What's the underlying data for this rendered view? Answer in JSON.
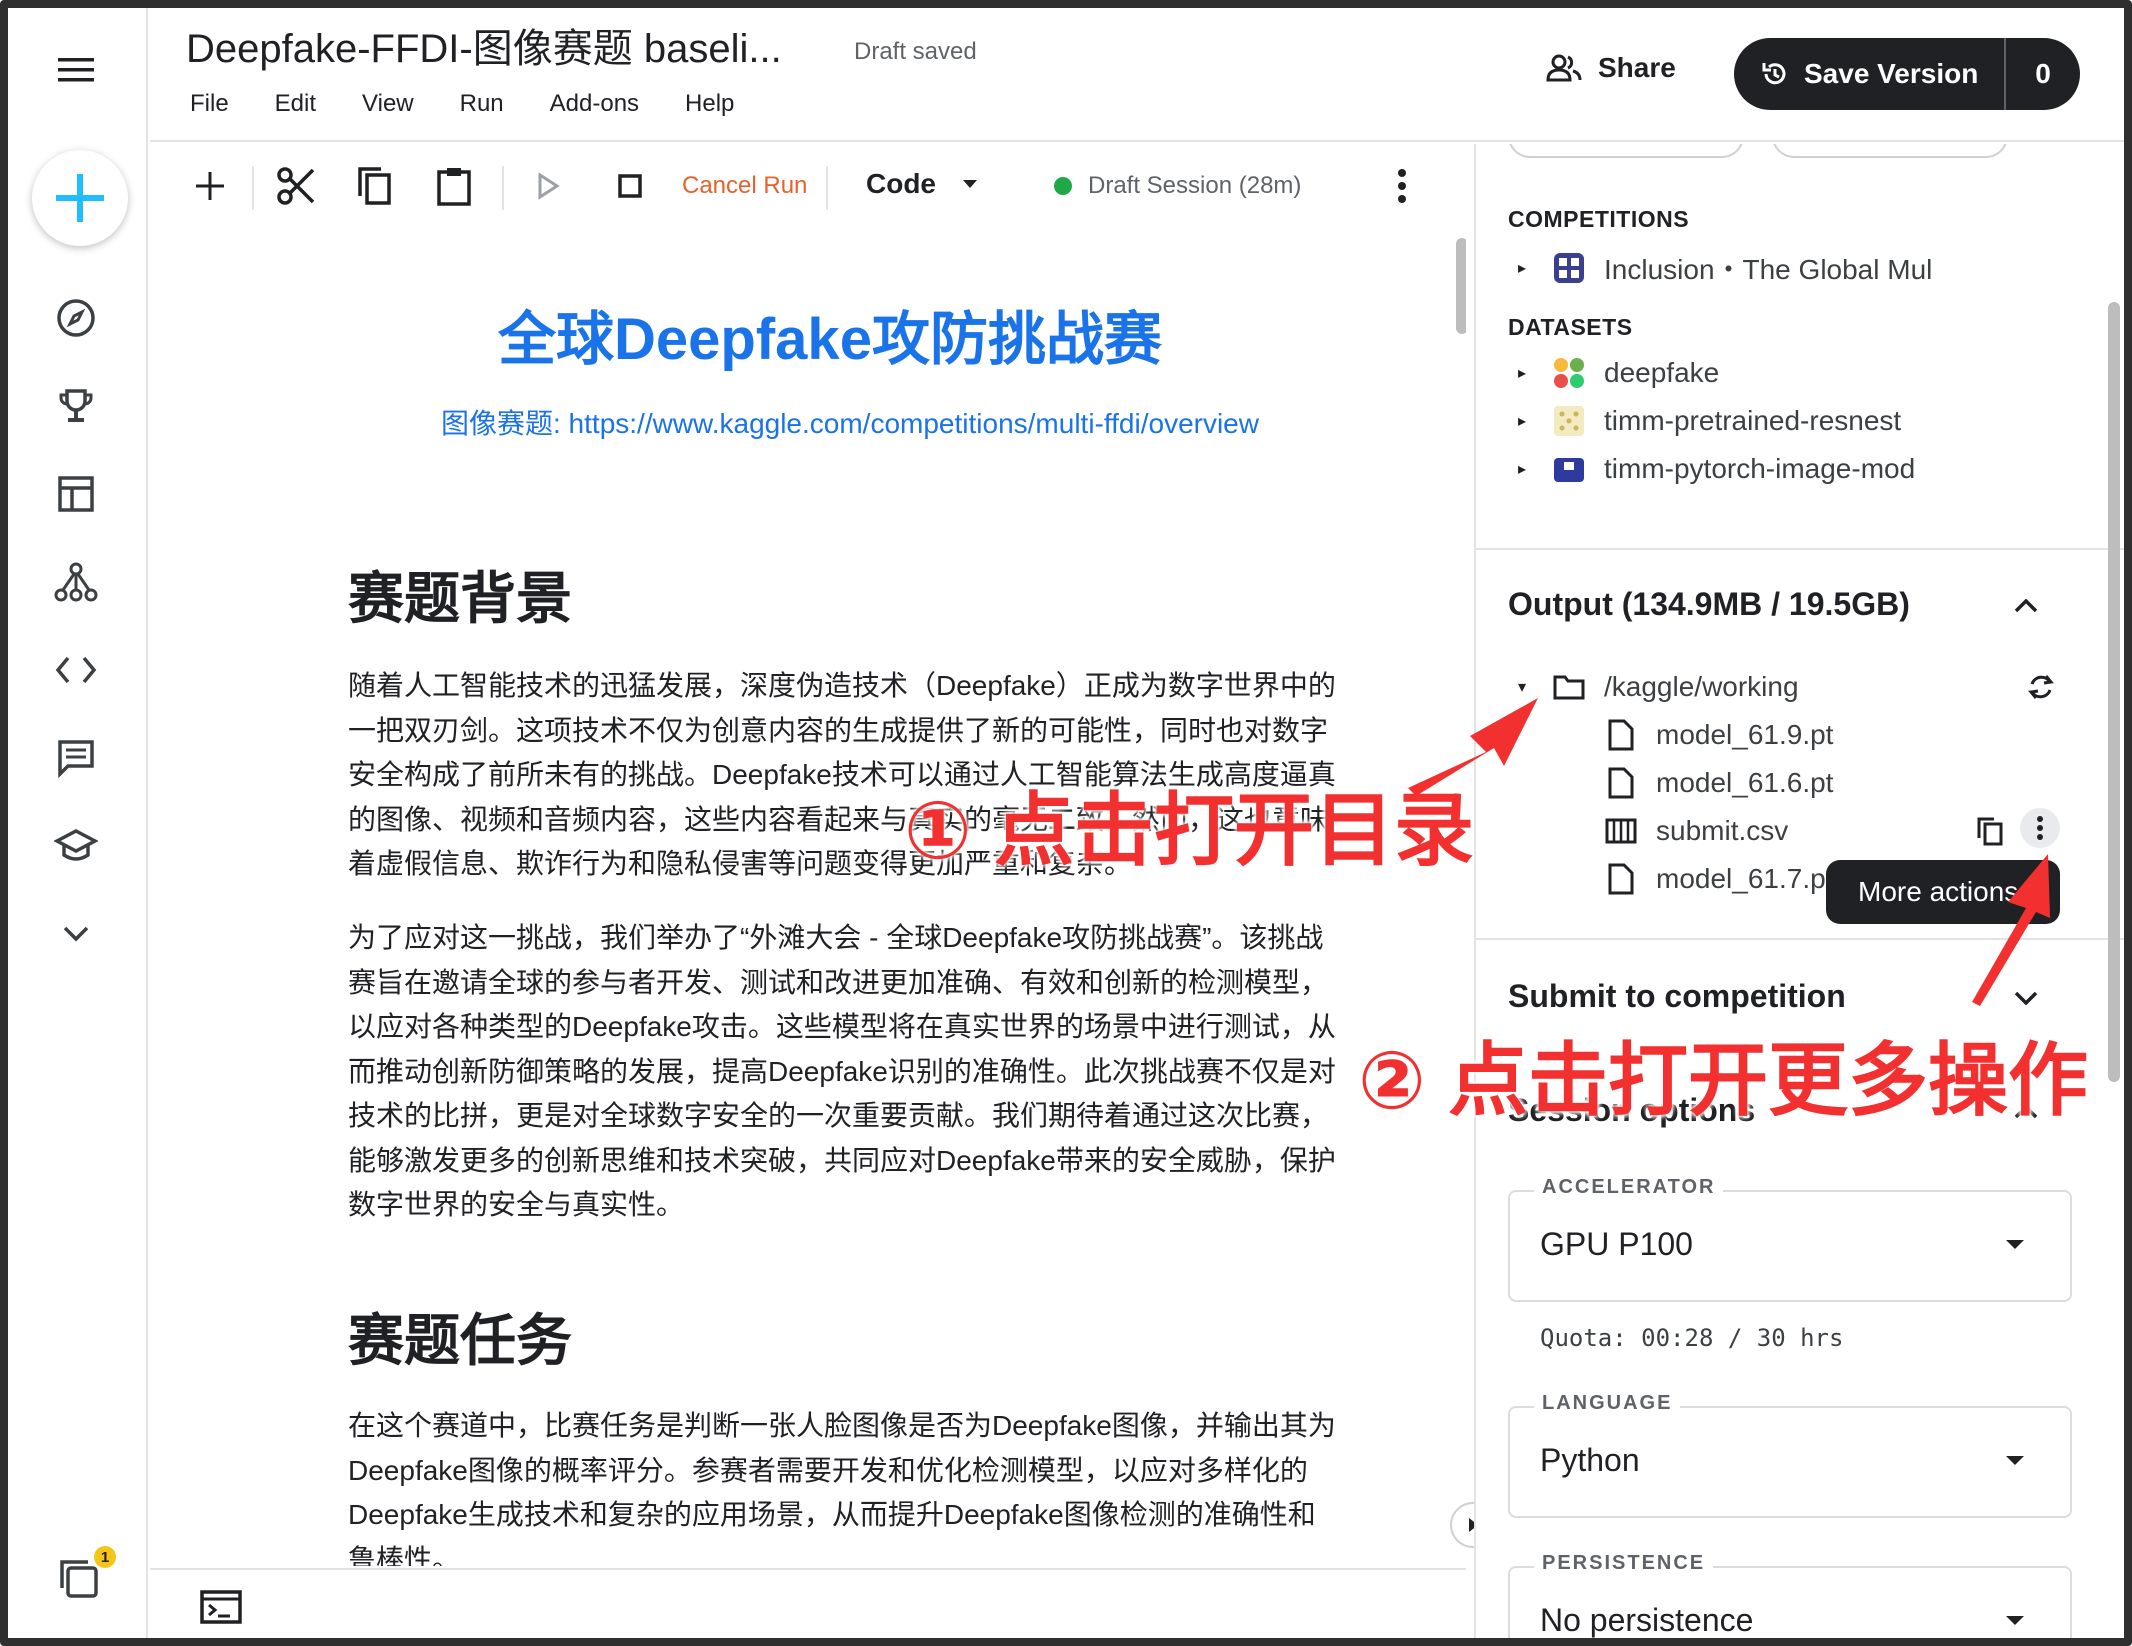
{
  "app": {
    "notebook_title": "Deepfake-FFDI-图像赛题 baseli...",
    "draft_status": "Draft saved",
    "menu": [
      "File",
      "Edit",
      "View",
      "Run",
      "Add-ons",
      "Help"
    ],
    "share_label": "Share",
    "save_version_label": "Save Version",
    "save_version_count": "0",
    "notification_count": "1"
  },
  "toolbar": {
    "cancel_run_label": "Cancel Run",
    "cell_type": "Code",
    "session_status": "Draft Session (28m)",
    "session_color": "#20a848"
  },
  "notebook": {
    "heading": "全球Deepfake攻防挑战赛",
    "link_text": "图像赛题: https://www.kaggle.com/competitions/multi-ffdi/overview",
    "section1_title": "赛题背景",
    "section1_p1": [
      "随着人工智能技术的迅猛发展，深度伪造技术（Deepfake）正成为数字世界中的",
      "一把双刃剑。这项技术不仅为创意内容的生成提供了新的可能性，同时也对数字",
      "安全构成了前所未有的挑战。Deepfake技术可以通过人工智能算法生成高度逼真",
      "的图像、视频和音频内容，这些内容看起来与真实的毫无二致。然而，这也意味",
      "着虚假信息、欺诈行为和隐私侵害等问题变得更加严重和复杂。"
    ],
    "section1_p2": [
      "为了应对这一挑战，我们举办了“外滩大会 - 全球Deepfake攻防挑战赛”。该挑战",
      "赛旨在邀请全球的参与者开发、测试和改进更加准确、有效和创新的检测模型，",
      "以应对各种类型的Deepfake攻击。这些模型将在真实世界的场景中进行测试，从",
      "而推动创新防御策略的发展，提高Deepfake识别的准确性。此次挑战赛不仅是对",
      "技术的比拼，更是对全球数字安全的一次重要贡献。我们期待着通过这次比赛，",
      "能够激发更多的创新思维和技术突破，共同应对Deepfake带来的安全威胁，保护",
      "数字世界的安全与真实性。"
    ],
    "section2_title": "赛题任务",
    "section2_p1": [
      "在这个赛道中，比赛任务是判断一张人脸图像是否为Deepfake图像，并输出其为",
      "Deepfake图像的概率评分。参赛者需要开发和优化检测模型，以应对多样化的",
      "Deepfake生成技术和复杂的应用场景，从而提升Deepfake图像检测的准确性和",
      "鲁棒性。"
    ]
  },
  "panel": {
    "competitions_label": "COMPETITIONS",
    "competitions": [
      "Inclusion・The Global Mul"
    ],
    "datasets_label": "DATASETS",
    "datasets": [
      "deepfake",
      "timm-pretrained-resnest",
      "timm-pytorch-image-mod"
    ],
    "output_title": "Output (134.9MB / 19.5GB)",
    "output_folder": "/kaggle/working",
    "output_files": [
      "model_61.9.pt",
      "model_61.6.pt",
      "submit.csv",
      "model_61.7.pt"
    ],
    "tooltip": "More actions",
    "submit_title": "Submit to competition",
    "session_title": "Session options",
    "accelerator_label": "ACCELERATOR",
    "accelerator_value": "GPU P100",
    "quota": "Quota: 00:28 / 30 hrs",
    "language_label": "LANGUAGE",
    "language_value": "Python",
    "persistence_label": "PERSISTENCE",
    "persistence_value": "No persistence"
  },
  "annotations": {
    "step1": "① 点击打开目录",
    "step2": "② 点击打开更多操作",
    "color": "#f23030"
  }
}
